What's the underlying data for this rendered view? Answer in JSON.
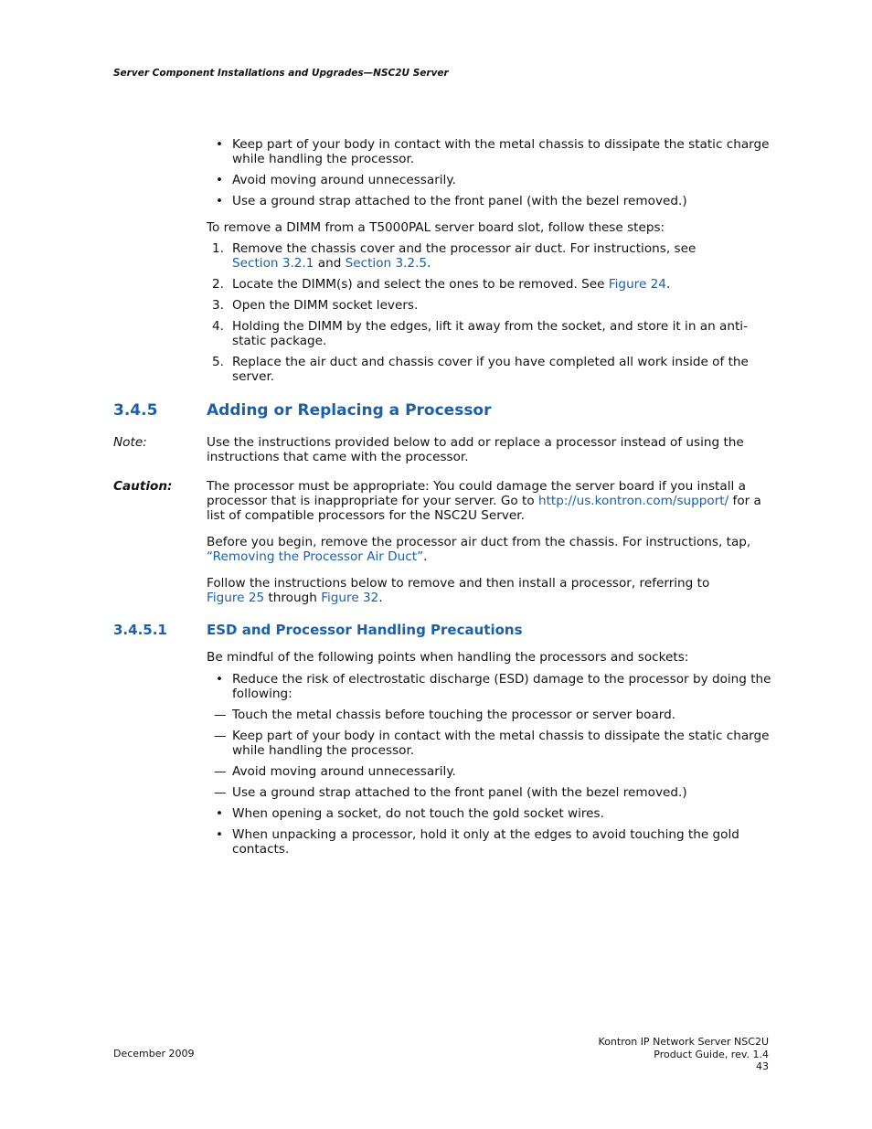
{
  "header": {
    "running_title": "Server Component Installations and Upgrades—NSC2U Server"
  },
  "top_bullets": [
    "Keep part of your body in contact with the metal chassis to dissipate the static charge while handling the processor.",
    "Avoid moving around unnecessarily.",
    "Use a ground strap attached to the front panel (with the bezel removed.)"
  ],
  "dimm_removal": {
    "intro": "To remove a DIMM from a T5000PAL server board slot, follow these steps:",
    "steps": [
      {
        "num": "1.",
        "text": "Remove the chassis cover and the processor air duct. For instructions, see",
        "link1": "Section 3.2.1",
        "mid": " and ",
        "link2": "Section 3.2.5",
        "end": "."
      },
      {
        "num": "2.",
        "text": "Locate the DIMM(s) and select the ones to be removed. See ",
        "link1": "Figure 24",
        "end": "."
      },
      {
        "num": "3.",
        "text": "Open the DIMM socket levers."
      },
      {
        "num": "4.",
        "text": "Holding the DIMM by the edges, lift it away from the socket, and store it in an anti-static package."
      },
      {
        "num": "5.",
        "text": "Replace the air duct and chassis cover if you have completed all work inside of the server."
      }
    ]
  },
  "section_345": {
    "number": "3.4.5",
    "title": "Adding or Replacing a Processor",
    "note_label": "Note:",
    "note_text": "Use the instructions provided below to add or replace a processor instead of using the instructions that came with the processor.",
    "caution_label": "Caution:",
    "caution_text": "The processor must be appropriate: You could damage the server board if you install a processor that is inappropriate for your server. Go to ",
    "caution_link": "http://us.kontron.com/support/",
    "caution_end": " for a list of compatible processors for the NSC2U Server.",
    "before_text": "Before you begin, remove the processor air duct from the chassis. For instructions, tap, ",
    "before_link": "“Removing the Processor Air Duct”",
    "before_end": ".",
    "follow_text": "Follow the instructions below to remove and then install a processor, referring to ",
    "follow_link1": "Figure 25",
    "follow_mid": " through ",
    "follow_link2": "Figure 32",
    "follow_end": "."
  },
  "section_3451": {
    "number": "3.4.5.1",
    "title": "ESD and Processor Handling Precautions",
    "intro": "Be mindful of the following points when handling the processors and sockets:",
    "bullet1": "Reduce the risk of electrostatic discharge (ESD) damage to the processor by doing the following:",
    "sub_bullets": [
      "Touch the metal chassis before touching the processor or server board.",
      "Keep part of your body in contact with the metal chassis to dissipate the static charge while handling the processor.",
      "Avoid moving around unnecessarily.",
      "Use a ground strap attached to the front panel (with the bezel removed.)"
    ],
    "bullet2": "When opening a socket, do not touch the gold socket wires.",
    "bullet3": "When unpacking a processor, hold it only at the edges to avoid touching the gold contacts."
  },
  "footer": {
    "date": "December 2009",
    "product": "Kontron IP Network Server NSC2U",
    "guide": "Product Guide, rev. 1.4",
    "page": "43"
  }
}
